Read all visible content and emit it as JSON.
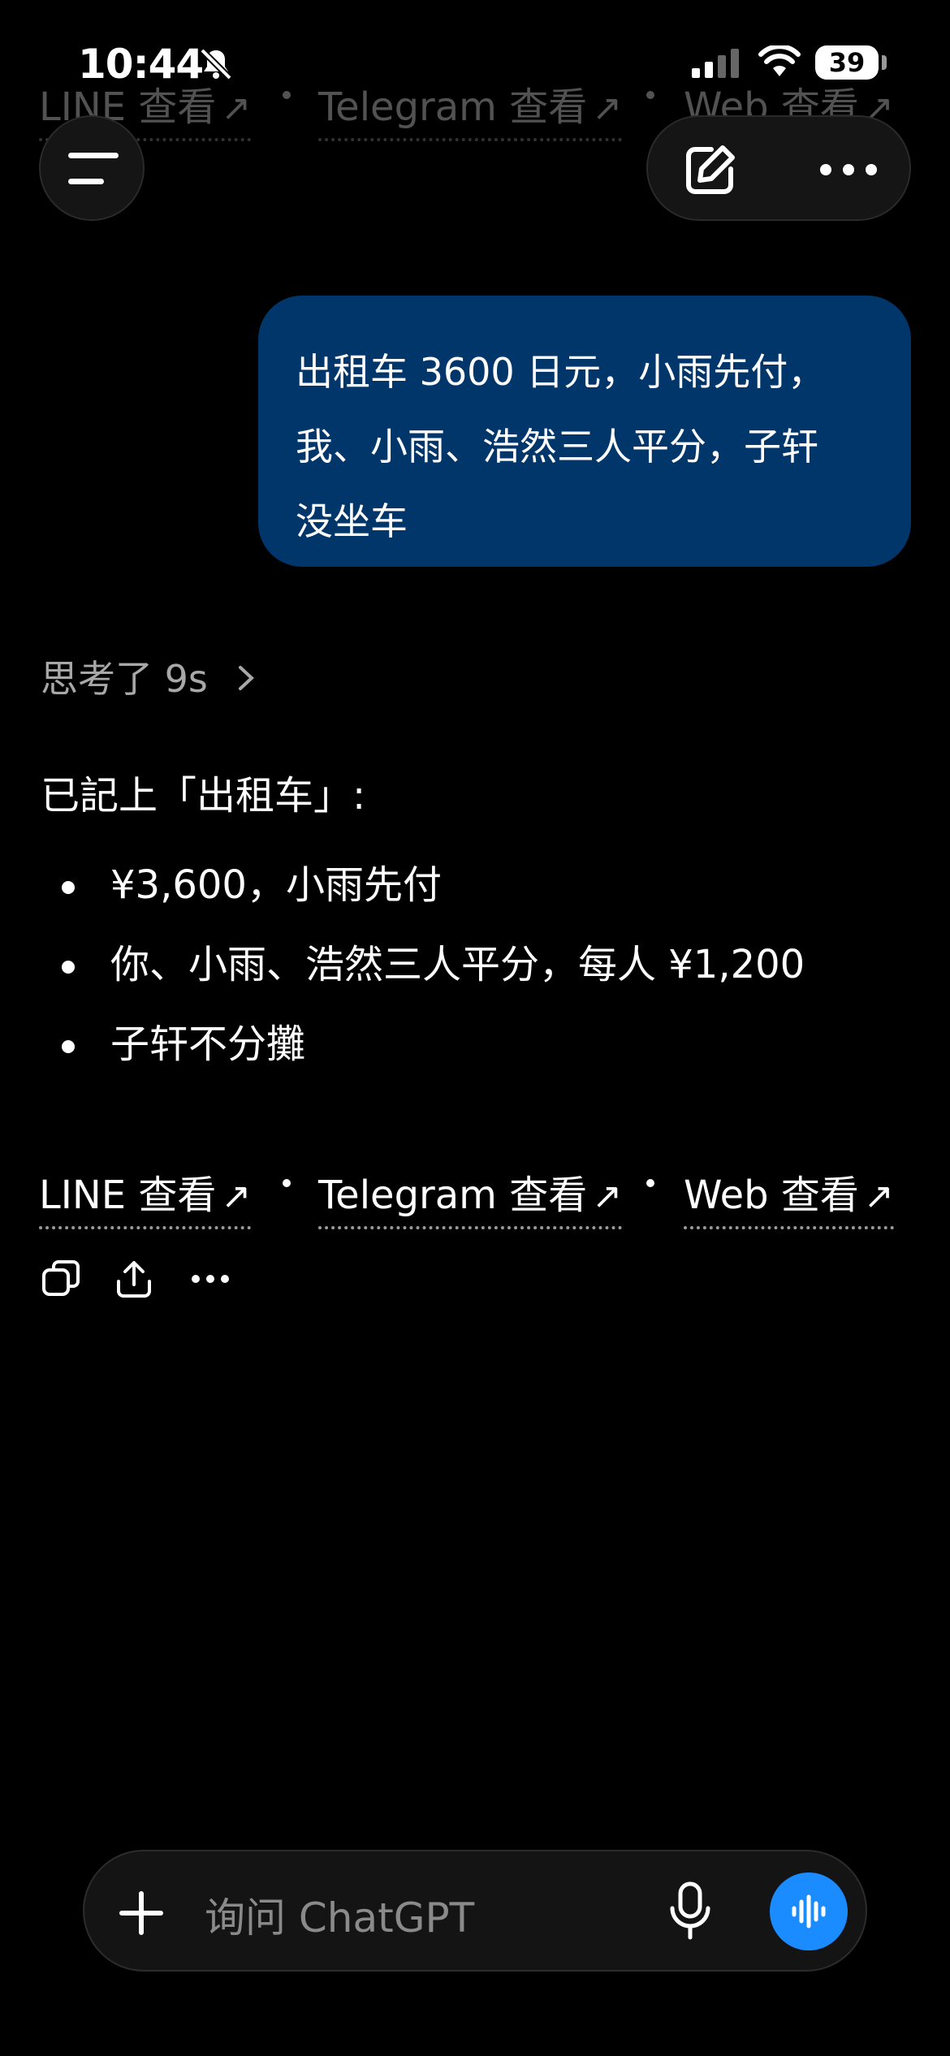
{
  "status_bar": {
    "time": "10:44",
    "battery": "39"
  },
  "user_message": {
    "lines": [
      "出租车 3600 日元，小雨先付，",
      "我、小雨、浩然三人平分，子轩",
      "没坐车"
    ]
  },
  "assistant": {
    "thought_label": "思考了 9s",
    "lead": "已記上「出租车」:",
    "bullets": [
      "¥3,600，小雨先付",
      "你、小雨、浩然三人平分，每人 ¥1,200",
      "子轩不分攤"
    ],
    "links": [
      {
        "label": "LINE 查看",
        "arrow": "↗"
      },
      {
        "label": "Telegram 查看",
        "arrow": "↗"
      },
      {
        "label": "Web 查看",
        "arrow": "↗"
      }
    ]
  },
  "composer": {
    "placeholder": "询问 ChatGPT"
  }
}
